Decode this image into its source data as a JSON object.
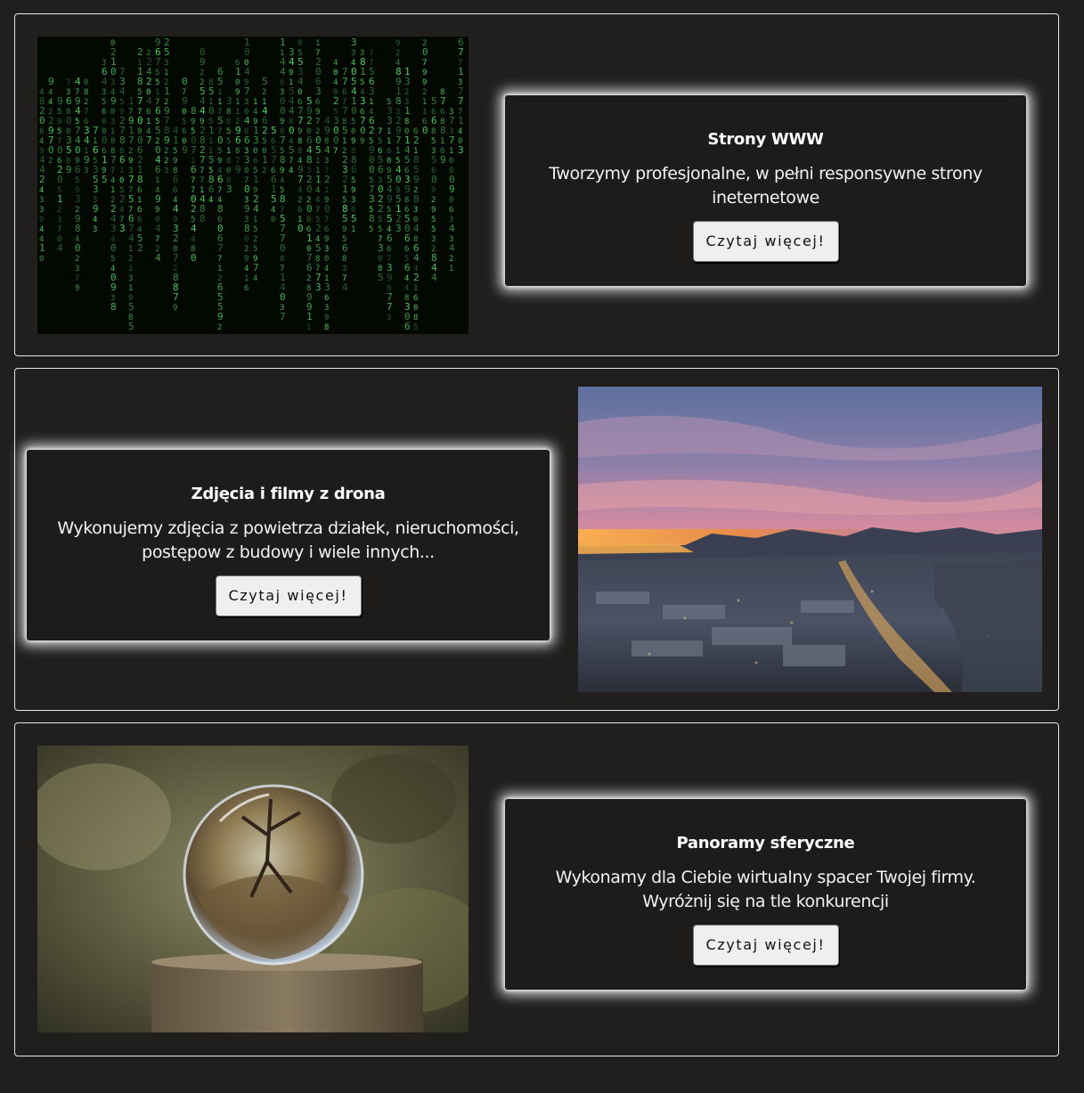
{
  "services": [
    {
      "title": "Strony WWW",
      "description_line1": "Tworzymy profesjonalne, w pełni responsywne strony",
      "description_line2": "ineternetowe",
      "button_label": "Czytaj więcej!",
      "image": "matrix-code-image"
    },
    {
      "title": "Zdjęcia i filmy z drona",
      "description_line1": "Wykonujemy zdjęcia z powietrza działek, nieruchomości,",
      "description_line2": "postępow z budowy i wiele innych...",
      "button_label": "Czytaj więcej!",
      "image": "aerial-city-sunset-image"
    },
    {
      "title": "Panoramy sferyczne",
      "description_line1": "Wykonamy dla Ciebie wirtualny spacer Twojej firmy.",
      "description_line2": "Wyróżnij się na tle konkurencji",
      "button_label": "Czytaj więcej!",
      "image": "crystal-ball-image"
    }
  ],
  "colors": {
    "page_background": "#201f1e",
    "card_background": "#1d1c1b",
    "section_border": "#e6e6e6",
    "matrix_green": "#4fd35a",
    "button_background": "#efefef"
  }
}
